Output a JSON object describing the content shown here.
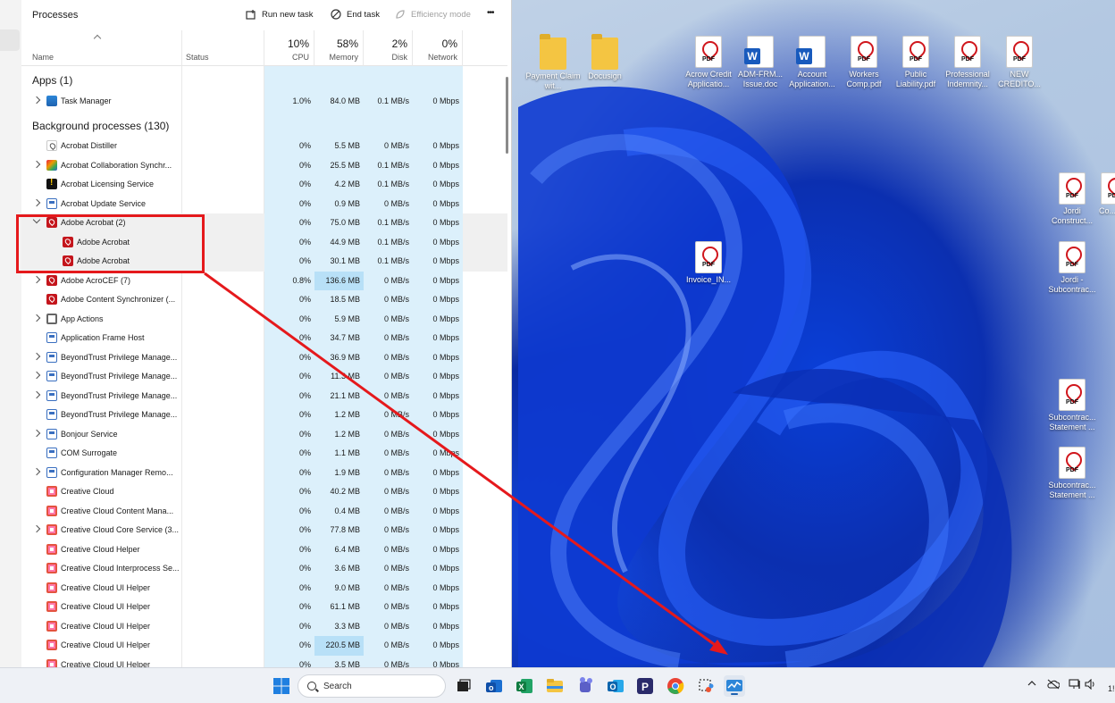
{
  "taskmanager": {
    "title": "Processes",
    "toolbar": {
      "run_new_task": "Run new task",
      "end_task": "End task",
      "efficiency_mode": "Efficiency mode",
      "more": "•••"
    },
    "columns": {
      "name": "Name",
      "status": "Status",
      "cpu_pct": "10%",
      "cpu": "CPU",
      "mem_pct": "58%",
      "memory": "Memory",
      "disk_pct": "2%",
      "disk": "Disk",
      "net_pct": "0%",
      "network": "Network"
    },
    "sections": {
      "apps": "Apps (1)",
      "background": "Background processes (130)"
    },
    "apps": [
      {
        "name": "Task Manager",
        "cpu": "1.0%",
        "mem": "84.0 MB",
        "disk": "0.1 MB/s",
        "net": "0 Mbps"
      }
    ],
    "background": [
      {
        "name": "Acrobat  Distiller",
        "cpu": "0%",
        "mem": "5.5 MB",
        "disk": "0 MB/s",
        "net": "0 Mbps"
      },
      {
        "name": "Acrobat Collaboration Synchr...",
        "cpu": "0%",
        "mem": "25.5 MB",
        "disk": "0.1 MB/s",
        "net": "0 Mbps"
      },
      {
        "name": "Acrobat Licensing Service",
        "cpu": "0%",
        "mem": "4.2 MB",
        "disk": "0.1 MB/s",
        "net": "0 Mbps"
      },
      {
        "name": "Acrobat Update Service",
        "cpu": "0%",
        "mem": "0.9 MB",
        "disk": "0 MB/s",
        "net": "0 Mbps"
      },
      {
        "name": "Adobe Acrobat (2)",
        "cpu": "0%",
        "mem": "75.0 MB",
        "disk": "0.1 MB/s",
        "net": "0 Mbps"
      },
      {
        "name": "Adobe Acrobat",
        "cpu": "0%",
        "mem": "44.9 MB",
        "disk": "0.1 MB/s",
        "net": "0 Mbps"
      },
      {
        "name": "Adobe Acrobat",
        "cpu": "0%",
        "mem": "30.1 MB",
        "disk": "0.1 MB/s",
        "net": "0 Mbps"
      },
      {
        "name": "Adobe AcroCEF (7)",
        "cpu": "0.8%",
        "mem": "136.6 MB",
        "disk": "0 MB/s",
        "net": "0 Mbps"
      },
      {
        "name": "Adobe Content Synchronizer (...",
        "cpu": "0%",
        "mem": "18.5 MB",
        "disk": "0 MB/s",
        "net": "0 Mbps"
      },
      {
        "name": "App Actions",
        "cpu": "0%",
        "mem": "5.9 MB",
        "disk": "0 MB/s",
        "net": "0 Mbps"
      },
      {
        "name": "Application Frame Host",
        "cpu": "0%",
        "mem": "34.7 MB",
        "disk": "0 MB/s",
        "net": "0 Mbps"
      },
      {
        "name": "BeyondTrust Privilege Manage...",
        "cpu": "0%",
        "mem": "36.9 MB",
        "disk": "0 MB/s",
        "net": "0 Mbps"
      },
      {
        "name": "BeyondTrust Privilege Manage...",
        "cpu": "0%",
        "mem": "11.3 MB",
        "disk": "0 MB/s",
        "net": "0 Mbps"
      },
      {
        "name": "BeyondTrust Privilege Manage...",
        "cpu": "0%",
        "mem": "21.1 MB",
        "disk": "0 MB/s",
        "net": "0 Mbps"
      },
      {
        "name": "BeyondTrust Privilege Manage...",
        "cpu": "0%",
        "mem": "1.2 MB",
        "disk": "0 MB/s",
        "net": "0 Mbps"
      },
      {
        "name": "Bonjour Service",
        "cpu": "0%",
        "mem": "1.2 MB",
        "disk": "0 MB/s",
        "net": "0 Mbps"
      },
      {
        "name": "COM Surrogate",
        "cpu": "0%",
        "mem": "1.1 MB",
        "disk": "0 MB/s",
        "net": "0 Mbps"
      },
      {
        "name": "Configuration Manager Remo...",
        "cpu": "0%",
        "mem": "1.9 MB",
        "disk": "0 MB/s",
        "net": "0 Mbps"
      },
      {
        "name": "Creative Cloud",
        "cpu": "0%",
        "mem": "40.2 MB",
        "disk": "0 MB/s",
        "net": "0 Mbps"
      },
      {
        "name": "Creative Cloud Content Mana...",
        "cpu": "0%",
        "mem": "0.4 MB",
        "disk": "0 MB/s",
        "net": "0 Mbps"
      },
      {
        "name": "Creative Cloud Core Service (3...",
        "cpu": "0%",
        "mem": "77.8 MB",
        "disk": "0 MB/s",
        "net": "0 Mbps"
      },
      {
        "name": "Creative Cloud Helper",
        "cpu": "0%",
        "mem": "6.4 MB",
        "disk": "0 MB/s",
        "net": "0 Mbps"
      },
      {
        "name": "Creative Cloud Interprocess Se...",
        "cpu": "0%",
        "mem": "3.6 MB",
        "disk": "0 MB/s",
        "net": "0 Mbps"
      },
      {
        "name": "Creative Cloud UI Helper",
        "cpu": "0%",
        "mem": "9.0 MB",
        "disk": "0 MB/s",
        "net": "0 Mbps"
      },
      {
        "name": "Creative Cloud UI Helper",
        "cpu": "0%",
        "mem": "61.1 MB",
        "disk": "0 MB/s",
        "net": "0 Mbps"
      },
      {
        "name": "Creative Cloud UI Helper",
        "cpu": "0%",
        "mem": "3.3 MB",
        "disk": "0 MB/s",
        "net": "0 Mbps"
      },
      {
        "name": "Creative Cloud UI Helper",
        "cpu": "0%",
        "mem": "220.5 MB",
        "disk": "0 MB/s",
        "net": "0 Mbps"
      },
      {
        "name": "Creative Cloud UI Helper",
        "cpu": "0%",
        "mem": "3.5 MB",
        "disk": "0 MB/s",
        "net": "0 Mbps"
      }
    ]
  },
  "desktop": {
    "icons": [
      {
        "label": "Payment Claim wit..."
      },
      {
        "label": "Docusign"
      },
      {
        "label": "Acrow Credit Applicatio..."
      },
      {
        "label": "ADM-FRM... Issue.doc"
      },
      {
        "label": "Account Application..."
      },
      {
        "label": "Workers Comp.pdf"
      },
      {
        "label": "Public Liability.pdf"
      },
      {
        "label": "Professional Indemnity..."
      },
      {
        "label": "NEW CREDITO..."
      },
      {
        "label": "Invoice_IN..."
      },
      {
        "label": "Jordi Construct..."
      },
      {
        "label": "Co..."
      },
      {
        "label": "Jordi - Subcontrac..."
      },
      {
        "label": "Subcontrac... Statement ..."
      },
      {
        "label": "Subcontrac... Statement ..."
      }
    ],
    "pdf_badge": "PDF",
    "word_badge": "W"
  },
  "taskbar": {
    "search_placeholder": "Search",
    "clock_partial": "1!"
  },
  "colors": {
    "annotation": "#e5191c",
    "heat_cell": "#dcf0fb",
    "heat_cell_high": "#b8e0f7"
  }
}
